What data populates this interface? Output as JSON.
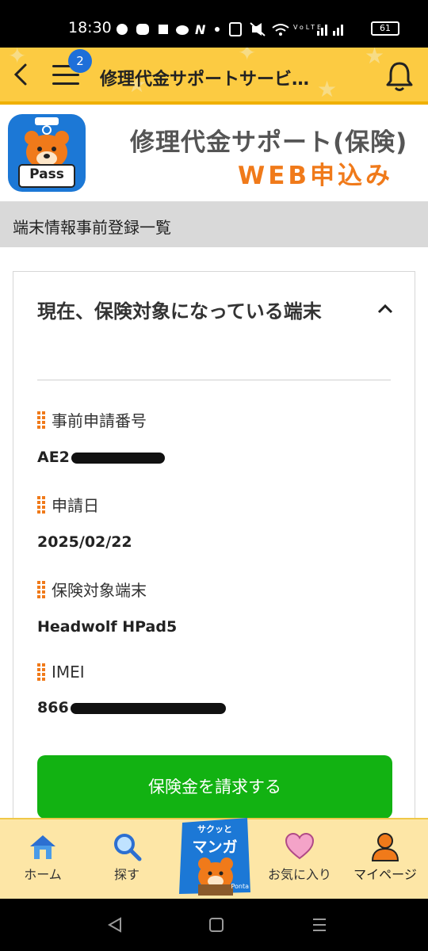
{
  "status_bar": {
    "time": "18:30",
    "battery": "61",
    "notification_icons": [
      "chat-icon",
      "line-icon",
      "box-icon",
      "cloud-icon",
      "n-icon",
      "dot-icon"
    ],
    "system_icons": [
      "nfc-icon",
      "mute-icon",
      "wifi-icon",
      "volte-icon",
      "signal-icon",
      "signal-icon"
    ]
  },
  "header": {
    "title": "修理代金サポートサービ…",
    "badge_count": "2",
    "accent_color": "#fccb42"
  },
  "banner": {
    "logo_text": "Pass",
    "title_line1": "修理代金サポート(保険)",
    "title_line2": "WEB申込み",
    "title2_color": "#f07a1a"
  },
  "section": {
    "title": "端末情報事前登録一覧"
  },
  "card": {
    "title": "現在、保険対象になっている端末",
    "fields": [
      {
        "label": "事前申請番号",
        "value": "AE2"
      },
      {
        "label": "申請日",
        "value": "2025/02/22"
      },
      {
        "label": "保険対象端末",
        "value": "Headwolf HPad5"
      },
      {
        "label": "IMEI",
        "value": "866"
      }
    ],
    "cta_label": "保険金を請求する",
    "cta_color": "#12b212"
  },
  "bottom_nav": {
    "items": [
      {
        "label": "ホーム",
        "icon": "home-icon"
      },
      {
        "label": "探す",
        "icon": "search-icon"
      },
      {
        "label": "",
        "icon": "manga-banner"
      },
      {
        "label": "お気に入り",
        "icon": "heart-icon"
      },
      {
        "label": "マイページ",
        "icon": "person-icon"
      }
    ],
    "manga_text_top": "サクッと",
    "manga_text_main": "マンガ",
    "manga_footer": "Ponta"
  },
  "android_nav": {
    "buttons": [
      "back-icon",
      "home-square-icon",
      "recents-icon"
    ]
  }
}
